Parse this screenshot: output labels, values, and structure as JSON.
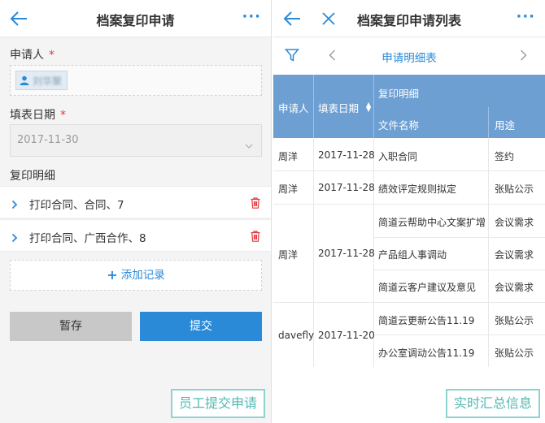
{
  "left": {
    "title": "档案复印申请",
    "more": "···",
    "applicant_label": "申请人",
    "required_mark": "*",
    "applicant_name": "刘华聚",
    "date_label": "填表日期",
    "date_value": "2017-11-30",
    "detail_label": "复印明细",
    "details": [
      "打印合同、合同、7",
      "打印合同、广西合作、8"
    ],
    "add_label": "添加记录",
    "save_label": "暂存",
    "submit_label": "提交",
    "caption": "员工提交申请"
  },
  "right": {
    "title": "档案复印申请列表",
    "more": "···",
    "subtitle": "申请明细表",
    "headers": {
      "applicant": "申请人",
      "date": "填表日期",
      "group": "复印明细",
      "file": "文件名称",
      "use": "用途"
    },
    "groups": [
      {
        "applicant": "周洋",
        "date": "2017-11-28",
        "items": [
          {
            "file": "入职合同",
            "use": "签约"
          }
        ]
      },
      {
        "applicant": "周洋",
        "date": "2017-11-28",
        "items": [
          {
            "file": "绩效评定规则拟定",
            "use": "张贴公示"
          }
        ]
      },
      {
        "applicant": "周洋",
        "date": "2017-11-28",
        "items": [
          {
            "file": "简道云帮助中心文案扩增",
            "use": "会议需求"
          },
          {
            "file": "产品组人事调动",
            "use": "会议需求"
          },
          {
            "file": "简道云客户建议及意见",
            "use": "会议需求"
          }
        ]
      },
      {
        "applicant": "davefly",
        "date": "2017-11-20",
        "items": [
          {
            "file": "简道云更新公告11.19",
            "use": "张贴公示"
          },
          {
            "file": "办公室调动公告11.19",
            "use": "张贴公示"
          }
        ]
      }
    ],
    "caption": "实时汇总信息"
  },
  "colors": {
    "accent": "#2a8ad8",
    "header": "#6d9fd2",
    "danger": "#e0393e",
    "caption": "#51b8b2"
  },
  "icons": [
    "back-arrow-icon",
    "close-icon",
    "filter-icon",
    "chevron-left-icon",
    "chevron-right-icon",
    "user-icon",
    "trash-icon",
    "plus-icon",
    "sort-icon"
  ]
}
